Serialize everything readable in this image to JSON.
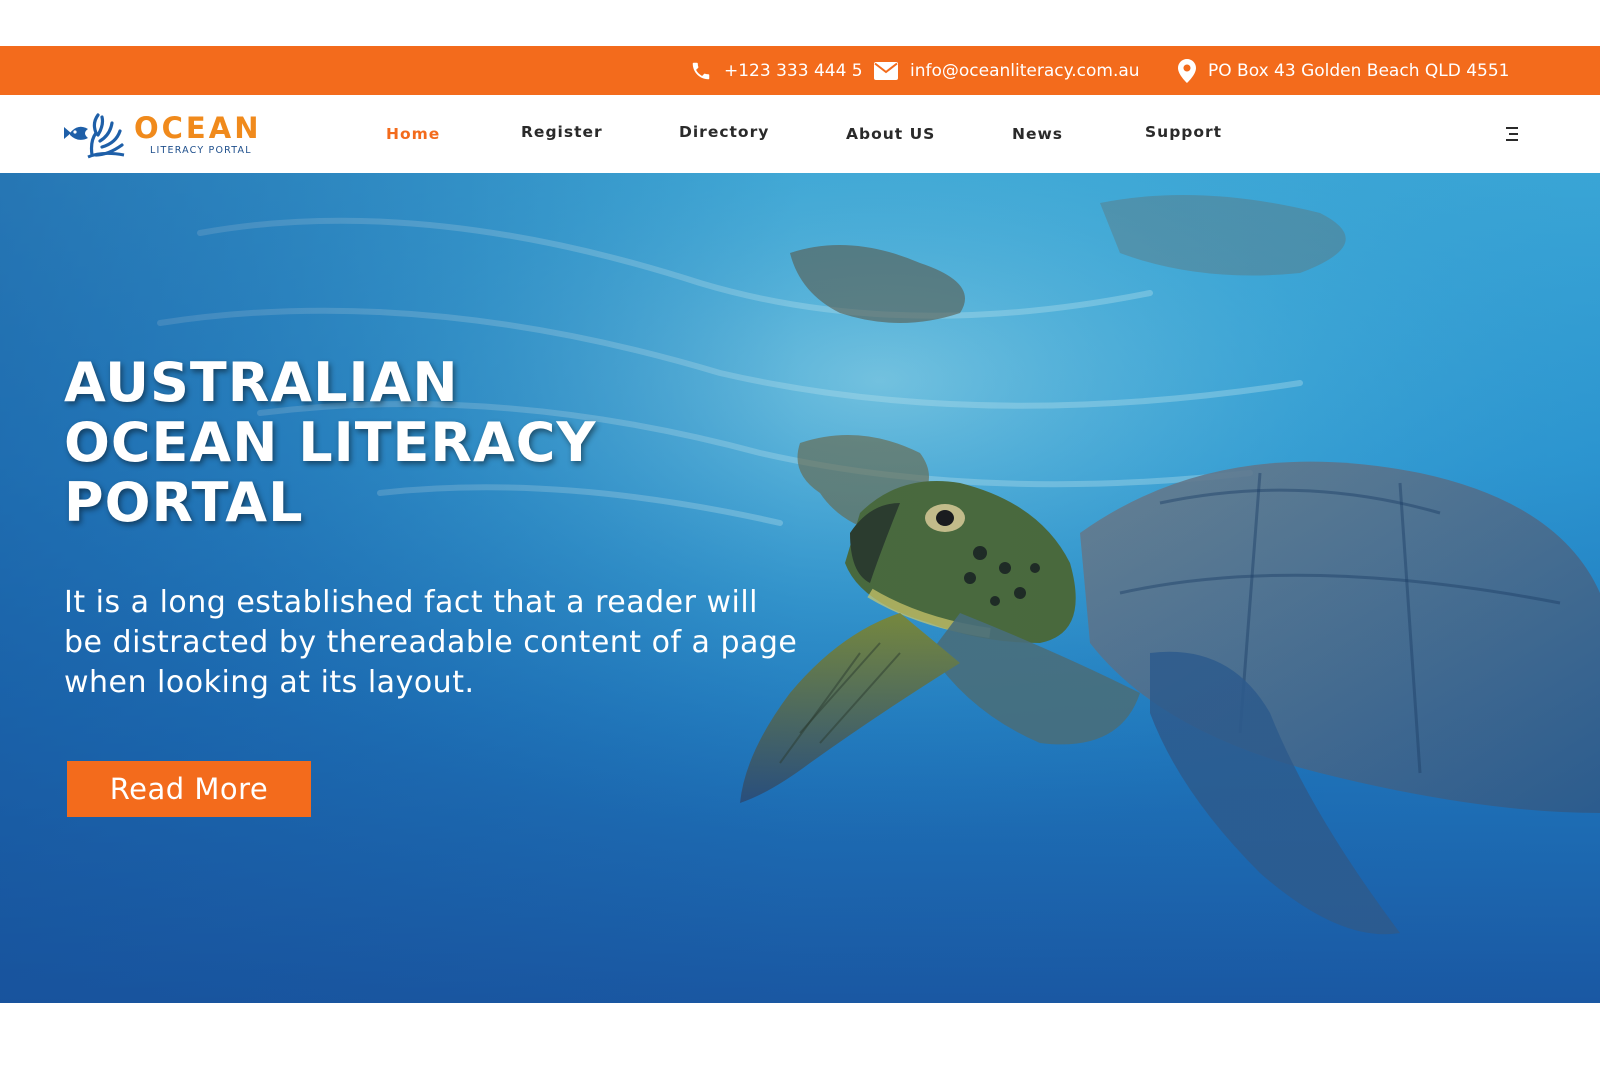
{
  "topbar": {
    "phone": "+123 333 444 5",
    "email": "info@oceanliteracy.com.au",
    "address": "PO Box 43 Golden Beach QLD 4551"
  },
  "brand": {
    "title": "OCEAN",
    "subtitle": "LITERACY PORTAL"
  },
  "nav": {
    "items": [
      {
        "label": "Home",
        "active": true
      },
      {
        "label": "Register"
      },
      {
        "label": "Directory"
      },
      {
        "label": "About US"
      },
      {
        "label": "News"
      },
      {
        "label": "Support"
      }
    ],
    "menu_icon": "hamburger-icon"
  },
  "hero": {
    "title_lines": [
      "AUSTRALIAN",
      "OCEAN LITERACY",
      "PORTAL"
    ],
    "subtitle": "It is a long established fact that a reader will be distracted by thereadable content of a page when looking at its layout.",
    "cta_label": "Read More",
    "image": "sea-turtle-underwater"
  },
  "colors": {
    "accent": "#f36b1c",
    "logo_orange": "#f08a1c",
    "logo_blue": "#1e4f8c",
    "nav_text": "#2a2a2a",
    "hero_blue": "#1b6fb6"
  },
  "icons": [
    "phone-icon",
    "mail-icon",
    "location-pin-icon",
    "hamburger-icon",
    "coral-fish-logo-icon"
  ]
}
